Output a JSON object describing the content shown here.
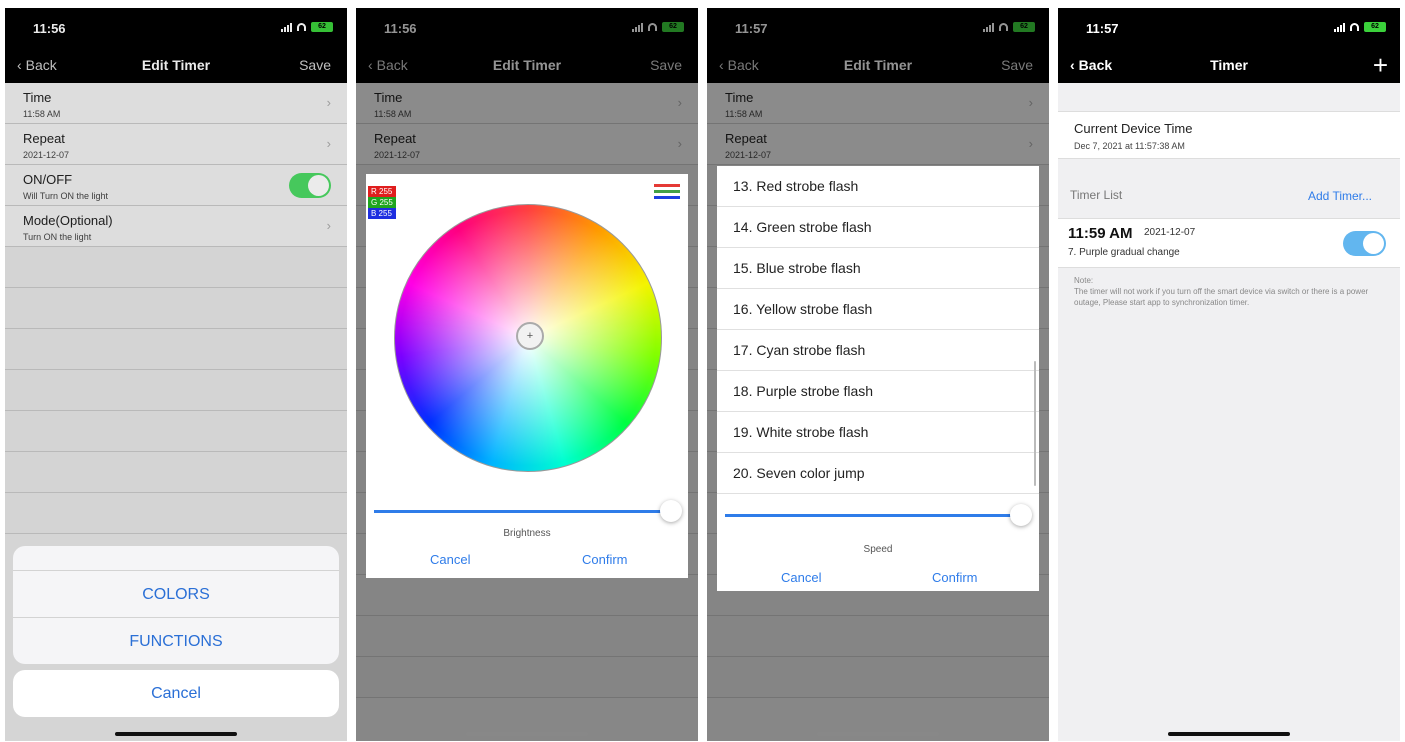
{
  "screens": {
    "p1": {
      "status_time": "11:56",
      "battery": "62",
      "back": "Back",
      "title": "Edit Timer",
      "save": "Save",
      "rows": [
        {
          "title": "Time",
          "sub": "11:58 AM"
        },
        {
          "title": "Repeat",
          "sub": "2021-12-07"
        },
        {
          "title": "ON/OFF",
          "sub": "Will Turn ON the light"
        },
        {
          "title": "Mode(Optional)",
          "sub": "Turn ON the light"
        }
      ],
      "sheet_options": [
        "COLORS",
        "FUNCTIONS"
      ],
      "cancel": "Cancel"
    },
    "p2": {
      "status_time": "11:56",
      "battery": "62",
      "back": "Back",
      "title": "Edit Timer",
      "save": "Save",
      "rows": [
        {
          "title": "Time",
          "sub": "11:58 AM"
        },
        {
          "title": "Repeat",
          "sub": "2021-12-07"
        }
      ],
      "rgb": {
        "r": "R 255",
        "g": "G 255",
        "b": "B 255"
      },
      "slider_label": "Brightness",
      "slider_value": 1.0,
      "cancel": "Cancel",
      "confirm": "Confirm"
    },
    "p3": {
      "status_time": "11:57",
      "battery": "62",
      "back": "Back",
      "title": "Edit Timer",
      "save": "Save",
      "rows": [
        {
          "title": "Time",
          "sub": "11:58 AM"
        },
        {
          "title": "Repeat",
          "sub": "2021-12-07"
        }
      ],
      "modes": [
        "13. Red strobe flash",
        "14. Green strobe flash",
        "15. Blue strobe flash",
        "16. Yellow strobe flash",
        "17. Cyan strobe flash",
        "18. Purple strobe flash",
        "19. White strobe flash",
        "20. Seven color jump"
      ],
      "slider_label": "Speed",
      "slider_value": 1.0,
      "cancel": "Cancel",
      "confirm": "Confirm"
    },
    "p4": {
      "status_time": "11:57",
      "battery": "62",
      "back": "Back",
      "title": "Timer",
      "current_label": "Current Device Time",
      "current_value": "Dec 7, 2021 at 11:57:38 AM",
      "timer_list": "Timer List",
      "add_timer": "Add Timer...",
      "timer_time": "11:59 AM",
      "timer_date": "2021-12-07",
      "timer_mode": "7. Purple gradual change",
      "note": "Note:\nThe timer will not work if you turn off the smart device via switch or there is a power outage, Please start app to synchronization timer."
    }
  },
  "colors": {
    "accent_blue": "#2f7ce9",
    "toggle_green": "#4cd964",
    "toggle_blue": "#62b6ef",
    "battery_green": "#3bd13b"
  }
}
